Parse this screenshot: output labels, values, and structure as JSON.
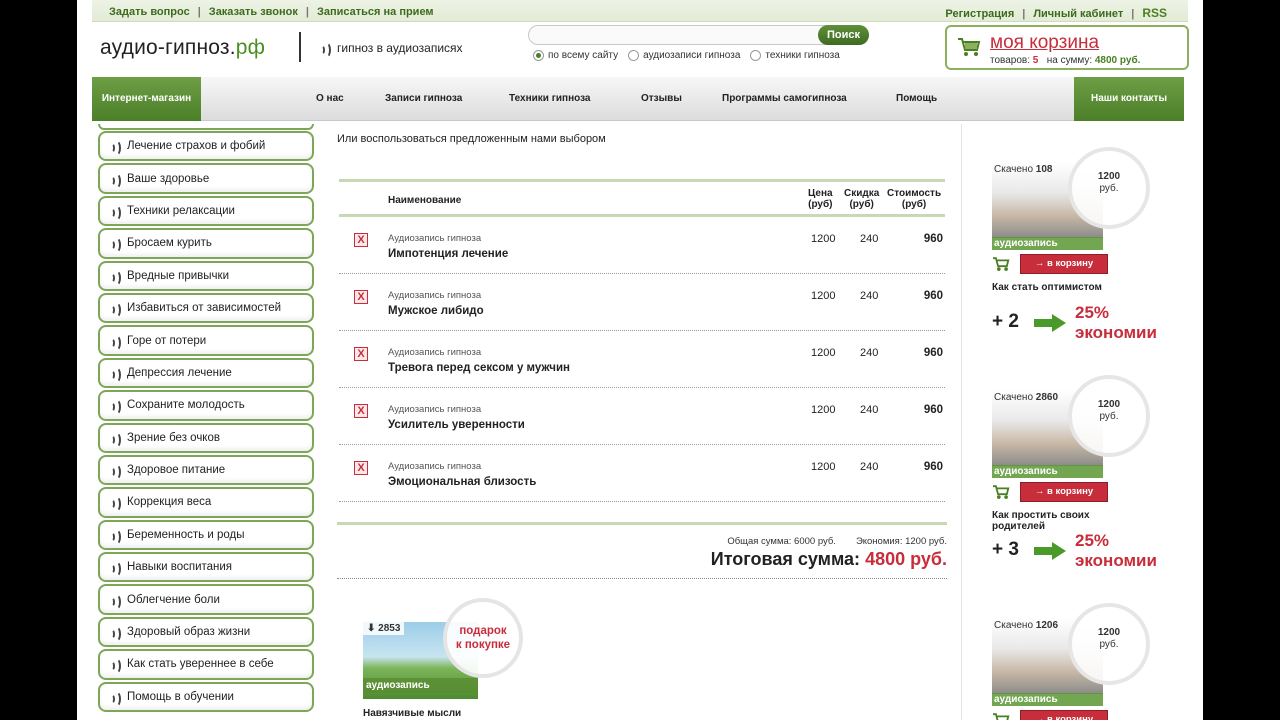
{
  "topbar": {
    "left_links": [
      "Задать вопрос",
      "Заказать звонок",
      "Записаться на прием"
    ],
    "right_links": [
      "Регистрация",
      "Личный кабинет"
    ],
    "rss": "RSS"
  },
  "header": {
    "logo_main": "аудио-гипноз.",
    "logo_tld": "рф",
    "slogan": "гипноз в аудиозаписях",
    "search_placeholder": "",
    "search_button": "Поиск",
    "search_scopes": [
      "по всему сайту",
      "аудиозаписи гипноза",
      "техники гипноза"
    ],
    "selected_scope": "по всему сайту"
  },
  "cart": {
    "title": "моя корзина",
    "items_label": "товаров:",
    "items_count": "5",
    "sum_label": "на сумму:",
    "sum_value": "4800 руб."
  },
  "nav": {
    "shop": "Интернет-магазин",
    "items": [
      "О нас",
      "Записи гипноза",
      "Техники гипноза",
      "Отзывы",
      "Программы самогипноза",
      "Помощь"
    ],
    "contacts": "Наши контакты"
  },
  "sidebar": {
    "items": [
      "Лечение страхов и фобий",
      "Ваше здоровье",
      "Техники релаксации",
      "Бросаем курить",
      "Вредные привычки",
      "Избавиться от зависимостей",
      "Горе от потери",
      "Депрессия лечение",
      "Сохраните молодость",
      "Зрение без очков",
      "Здоровое питание",
      "Коррекция веса",
      "Беременность и роды",
      "Навыки воспитания",
      "Облегчение боли",
      "Здоровый образ жизни",
      "Как стать увереннее в себе",
      "Помощь в обучении"
    ]
  },
  "main": {
    "intro": "Или воспользоваться предложенным нами выбором",
    "columns": {
      "name": "Наименование",
      "price_1": "Цена",
      "price_2": "(руб)",
      "discount_1": "Скидка",
      "discount_2": "(руб)",
      "cost_1": "Стоимость",
      "cost_2": "(руб)"
    },
    "delete_icon": "X",
    "rows": [
      {
        "type": "Аудиозапись гипноза",
        "title": "Импотенция лечение",
        "price": "1200",
        "discount": "240",
        "cost": "960"
      },
      {
        "type": "Аудиозапись гипноза",
        "title": "Мужское либидо",
        "price": "1200",
        "discount": "240",
        "cost": "960"
      },
      {
        "type": "Аудиозапись гипноза",
        "title": "Тревога перед сексом у мужчин",
        "price": "1200",
        "discount": "240",
        "cost": "960"
      },
      {
        "type": "Аудиозапись гипноза",
        "title": "Усилитель уверенности",
        "price": "1200",
        "discount": "240",
        "cost": "960"
      },
      {
        "type": "Аудиозапись гипноза",
        "title": "Эмоциональная близость",
        "price": "1200",
        "discount": "240",
        "cost": "960"
      }
    ],
    "total_sum": "Общая сумма: 6000 руб.",
    "savings": "Экономия: 1200 руб.",
    "final_label": "Итоговая сумма:",
    "final_value": "4800 руб."
  },
  "gift": {
    "downloads": "2853",
    "label": "аудиозапись",
    "badge_1": "подарок",
    "badge_2": "к покупке",
    "title": "Навязчивые мысли"
  },
  "right": {
    "downloaded_label": "Скачено",
    "currency": "руб.",
    "audio_label": "аудиозапись",
    "buy_label": "в корзину",
    "cards": [
      {
        "downloads": "108",
        "price": "1200",
        "title": "Как стать оптимистом"
      },
      {
        "downloads": "2860",
        "price": "1200",
        "title": "Как простить своих родителей"
      },
      {
        "downloads": "1206",
        "price": "1200",
        "title": ""
      }
    ],
    "promos": [
      {
        "plus": "+ 2",
        "pct": "25%",
        "word": "экономии"
      },
      {
        "plus": "+ 3",
        "pct": "25%",
        "word": "экономии"
      }
    ]
  },
  "colors": {
    "accent_green": "#4a7f22",
    "accent_red": "#c72d3a"
  }
}
